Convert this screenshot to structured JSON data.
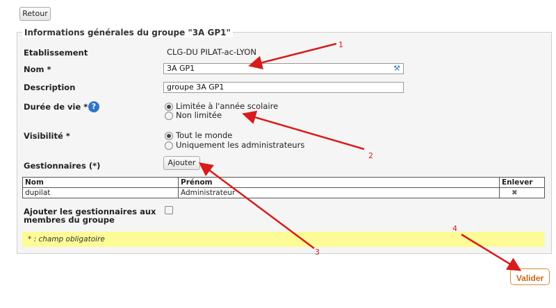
{
  "back_button": "Retour",
  "form": {
    "legend": "Informations générales du groupe \"3A GP1\"",
    "etablissement": {
      "label": "Etablissement",
      "value": "CLG-DU PILAT-ac-LYON"
    },
    "nom": {
      "label": "Nom *",
      "value": "3A GP1"
    },
    "description": {
      "label": "Description",
      "value": "groupe 3A GP1"
    },
    "duree": {
      "label": "Durée de vie *",
      "options": [
        "Limitée à l'année scolaire",
        "Non limitée"
      ],
      "selected": 0
    },
    "visibilite": {
      "label": "Visibilité *",
      "options": [
        "Tout le monde",
        "Uniquement les administrateurs"
      ],
      "selected": 0
    },
    "gestionnaires": {
      "label": "Gestionnaires (*)",
      "add_button": "Ajouter"
    },
    "table": {
      "headers": [
        "Nom",
        "Prénom",
        "Enlever"
      ],
      "rows": [
        {
          "nom": "dupilat",
          "prenom": "Administrateur"
        }
      ]
    },
    "ajouter_membres": {
      "label_line1": "Ajouter les gestionnaires aux",
      "label_line2": "membres du groupe",
      "checked": false
    },
    "note": "* : champ obligatoire"
  },
  "submit_button": "Valider",
  "annotations": [
    "1",
    "2",
    "3",
    "4"
  ],
  "colors": {
    "annotation": "#d81b1b",
    "note_bg": "#fdfb96",
    "submit": "#d8893b"
  }
}
